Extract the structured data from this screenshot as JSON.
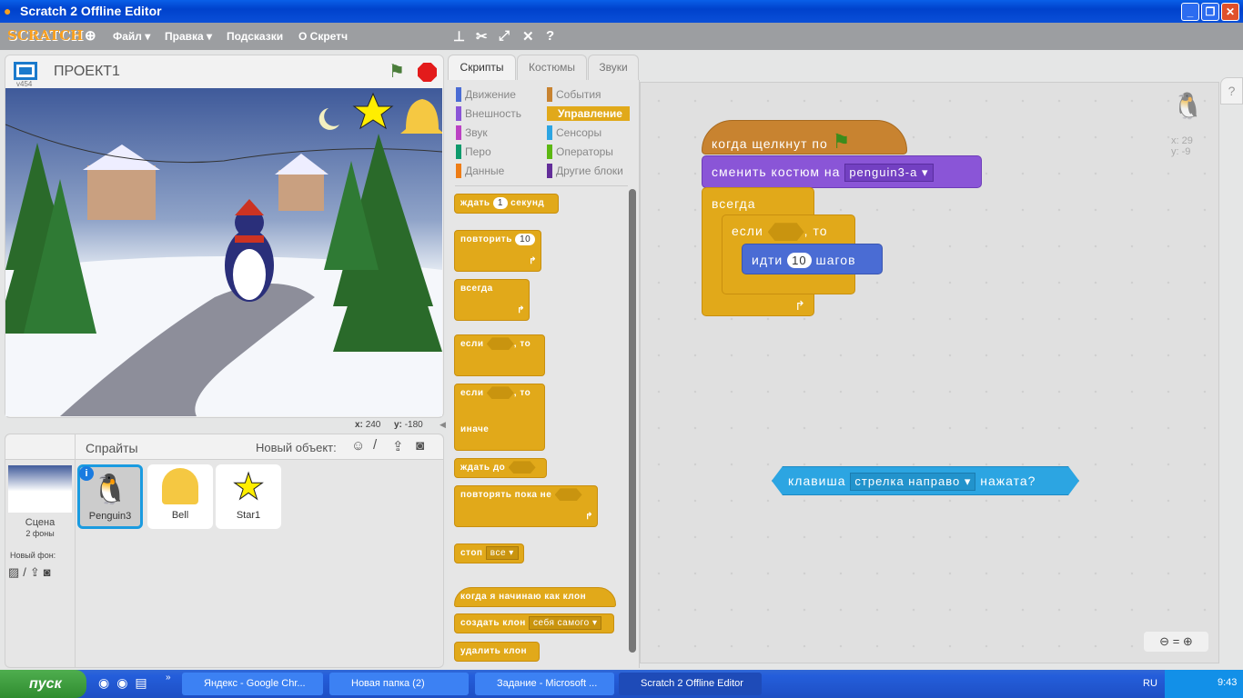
{
  "window": {
    "title": "Scratch 2 Offline Editor",
    "controls": [
      "_",
      "❐",
      "✕"
    ]
  },
  "menu": {
    "logo": "SCRATCH",
    "items": [
      "Файл ▾",
      "Правка ▾",
      "Подсказки",
      "О Скретч"
    ],
    "toolbar_icons": [
      "stamp-icon",
      "cut-icon",
      "grow-icon",
      "shrink-icon",
      "help-icon"
    ]
  },
  "stage": {
    "version": "v454",
    "project_title": "ПРОЕКТ1",
    "x_label": "x:",
    "x": "240",
    "y_label": "y:",
    "y": "-180"
  },
  "sprites": {
    "header": "Спрайты",
    "new_object": "Новый объект:",
    "items": [
      {
        "name": "Penguin3",
        "selected": true
      },
      {
        "name": "Bell"
      },
      {
        "name": "Star1"
      }
    ],
    "scene": {
      "label": "Сцена",
      "backdrops": "2 фоны",
      "new_backdrop": "Новый фон:"
    }
  },
  "tabs": [
    "Скрипты",
    "Костюмы",
    "Звуки"
  ],
  "categories": [
    {
      "label": "Движение",
      "color": "#4a6cd4"
    },
    {
      "label": "События",
      "color": "#c88330"
    },
    {
      "label": "Внешность",
      "color": "#8a55d7"
    },
    {
      "label": "Управление",
      "color": "#e1a91a",
      "active": true
    },
    {
      "label": "Звук",
      "color": "#bb42c3"
    },
    {
      "label": "Сенсоры",
      "color": "#2ca5e2"
    },
    {
      "label": "Перо",
      "color": "#0e9a6c"
    },
    {
      "label": "Операторы",
      "color": "#5cb712"
    },
    {
      "label": "Данные",
      "color": "#ee7d16"
    },
    {
      "label": "Другие блоки",
      "color": "#632d99"
    }
  ],
  "palette": {
    "wait": "ждать",
    "wait_val": "1",
    "wait_unit": "секунд",
    "repeat": "повторить",
    "repeat_val": "10",
    "forever": "всегда",
    "if": "если",
    "then": ", то",
    "else": "иначе",
    "wait_until": "ждать до",
    "repeat_until": "повторять пока не",
    "stop": "стоп",
    "stop_val": "все",
    "clone_start": "когда я начинаю как клон",
    "create_clone": "создать клон",
    "create_clone_val": "себя самого",
    "delete_clone": "удалить клон"
  },
  "script": {
    "hat": "когда щелкнут по",
    "switch_costume": "сменить костюм на",
    "costume": "penguin3-a",
    "forever": "всегда",
    "if": "если",
    "then": ", то",
    "move": "идти",
    "move_val": "10",
    "move_unit": "шагов",
    "sensing": {
      "key": "клавиша",
      "key_val": "стрелка направо",
      "pressed": "нажата?"
    },
    "sprite_x": "x: 29",
    "sprite_y": "y: -9"
  },
  "taskbar": {
    "start": "пуск",
    "tasks": [
      "Яндекс - Google Chr...",
      "Новая папка (2)",
      "Задание - Microsoft ...",
      "Scratch 2 Offline Editor"
    ],
    "lang": "RU",
    "clock": "9:43"
  }
}
